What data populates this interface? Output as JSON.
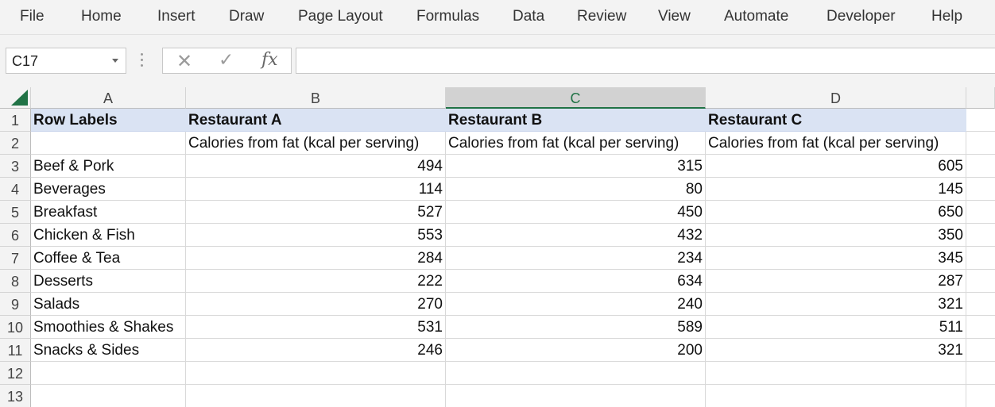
{
  "ribbon": {
    "tabs": [
      "File",
      "Home",
      "Insert",
      "Draw",
      "Page Layout",
      "Formulas",
      "Data",
      "Review",
      "View",
      "Automate",
      "Developer",
      "Help"
    ]
  },
  "formula_bar": {
    "name_box": "C17",
    "cancel_icon": "✕",
    "enter_icon": "✓",
    "fx_label": "fx",
    "formula": ""
  },
  "sheet": {
    "selected_column": "C",
    "columns": [
      "A",
      "B",
      "C",
      "D"
    ],
    "row_numbers": [
      "1",
      "2",
      "3",
      "4",
      "5",
      "6",
      "7",
      "8",
      "9",
      "10",
      "11",
      "12",
      "13"
    ],
    "rows": [
      [
        "Row Labels",
        "Restaurant A",
        "Restaurant B",
        "Restaurant C"
      ],
      [
        "",
        "Calories from fat (kcal per serving)",
        "Calories from fat (kcal per serving)",
        "Calories from fat (kcal per serving)"
      ],
      [
        "Beef & Pork",
        "494",
        "315",
        "605"
      ],
      [
        "Beverages",
        "114",
        "80",
        "145"
      ],
      [
        "Breakfast",
        "527",
        "450",
        "650"
      ],
      [
        "Chicken & Fish",
        "553",
        "432",
        "350"
      ],
      [
        "Coffee & Tea",
        "284",
        "234",
        "345"
      ],
      [
        "Desserts",
        "222",
        "634",
        "287"
      ],
      [
        "Salads",
        "270",
        "240",
        "321"
      ],
      [
        "Smoothies & Shakes",
        "531",
        "589",
        "511"
      ],
      [
        "Snacks & Sides",
        "246",
        "200",
        "321"
      ],
      [
        "",
        "",
        "",
        ""
      ],
      [
        "",
        "",
        "",
        ""
      ]
    ]
  },
  "colors": {
    "accent": "#217346",
    "header_fill": "#dae3f3"
  }
}
